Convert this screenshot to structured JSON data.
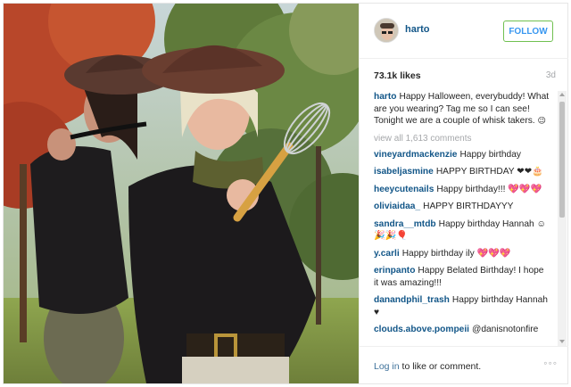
{
  "post": {
    "username": "harto",
    "follow_label": "FOLLOW",
    "likes": "73.1k likes",
    "age": "3d"
  },
  "caption": {
    "user": "harto",
    "text": "Happy Halloween, everybuddy! What are you wearing? Tag me so I can see! Tonight we are a couple of whisk takers.",
    "emoji": "😉"
  },
  "view_all": "view all 1,613 comments",
  "comments": [
    {
      "user": "vineyardmackenzie",
      "text": "Happy birthday"
    },
    {
      "user": "isabeljasmine",
      "text": "HAPPY BIRTHDAY ❤❤🎂"
    },
    {
      "user": "heeycutenails",
      "text": "Happy birthday!!! 💖💖💖"
    },
    {
      "user": "oliviaidaa_",
      "text": "HAPPY BIRTHDAYYY"
    },
    {
      "user": "sandra__mtdb",
      "text": "Happy birthday Hannah ☺🎉🎉🎈"
    },
    {
      "user": "y.carli",
      "text": "Happy birthday ily 💖💖💖"
    },
    {
      "user": "erinpanto",
      "text": "Happy Belated Birthday! I hope it was amazing!!!"
    },
    {
      "user": "danandphil_trash",
      "text": "Happy birthday Hannah ♥"
    },
    {
      "user": "clouds.above.pompeii",
      "text": "@danisnotonfire"
    }
  ],
  "footer": {
    "login_link": "Log in",
    "login_rest": " to like or comment.",
    "more": "◦◦◦"
  },
  "colors": {
    "username_blue": "#125688",
    "follow_border": "#70c050",
    "link_blue": "#3f729b",
    "muted": "#a5a7aa"
  }
}
